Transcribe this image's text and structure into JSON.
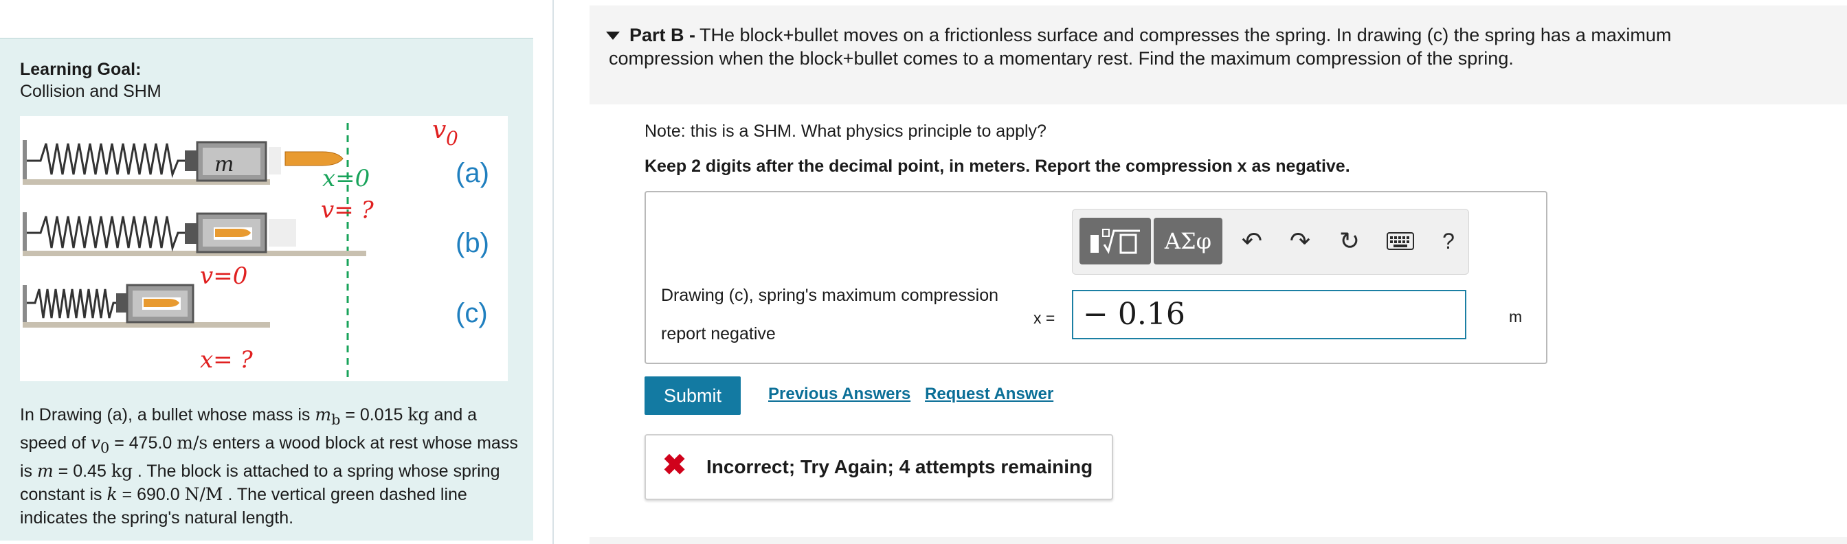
{
  "learning_goal": {
    "title": "Learning Goal:",
    "text": "Collision and SHM"
  },
  "figure": {
    "v0_label": "v",
    "v0_sub": "0",
    "mass_label": "m",
    "x0_label": "x=0",
    "v_unknown_label": "v= ?",
    "v_zero_label": "v=0",
    "x_unknown_label": "x= ?",
    "label_a": "(a)",
    "label_b": "(b)",
    "label_c": "(c)"
  },
  "problem": {
    "p1": "In Drawing (a), a bullet whose mass is ",
    "mb_sym": "m",
    "mb_sub": "b",
    "mb_eq": " = 0.015 ",
    "mb_unit": "kg",
    "p2": " and a speed of ",
    "v0_sym": "v",
    "v0_sub": "0",
    "v0_eq": " = 475.0 ",
    "v0_unit": "m/s",
    "p3": " enters a wood block at rest whose mass is ",
    "m_sym": "m",
    "m_eq": " = 0.45 ",
    "m_unit": "kg",
    "p4": " . The block is attached to a spring whose spring constant is ",
    "k_sym": "k",
    "k_eq": " = 690.0 ",
    "k_unit": "N/M",
    "p5": " . The vertical green dashed line indicates the spring's natural length."
  },
  "part": {
    "title": "Part B -",
    "text": "THe block+bullet moves on a frictionless surface and compresses the spring. In drawing (c) the spring has a maximum compression when the block+bullet comes to a momentary rest. Find the maximum compression of the spring."
  },
  "note": "Note: this is a SHM. What physics principle to apply?",
  "instruction": "Keep 2 digits after the decimal point, in meters. Report the compression x as negative.",
  "answer": {
    "label_line1": "Drawing (c), spring's maximum compression",
    "label_line2": "report negative",
    "variable": "x =",
    "value": "− 0.16",
    "unit": "m"
  },
  "toolbar": {
    "greek_label": "ΑΣφ",
    "undo_icon": "↶",
    "redo_icon": "↷",
    "reset_icon": "↻",
    "help_label": "?"
  },
  "actions": {
    "submit": "Submit",
    "previous_answers": "Previous Answers",
    "request_answer": "Request Answer"
  },
  "feedback": {
    "icon": "✖",
    "text": "Incorrect; Try Again; 4 attempts remaining"
  },
  "colors": {
    "panel_bg": "#e3f1f1",
    "accent": "#137aa2",
    "link": "#0b6f97",
    "error": "#d0021b",
    "figure_red": "#e02020",
    "figure_green": "#18a35a",
    "figure_blue": "#1f7fbf"
  }
}
